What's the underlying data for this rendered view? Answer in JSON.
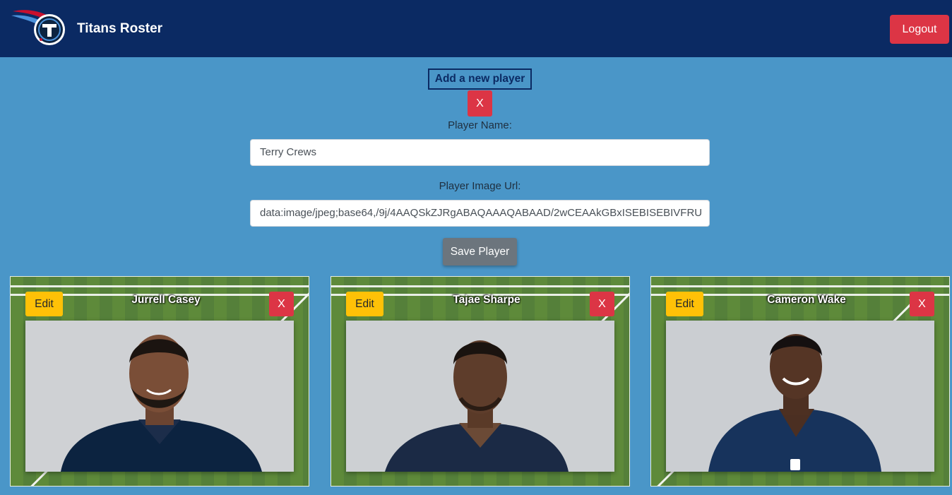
{
  "navbar": {
    "brand": "Titans Roster",
    "logout_label": "Logout",
    "logo_icon": "titans-logo"
  },
  "form": {
    "add_label": "Add a new player",
    "close_label": "X",
    "name_label": "Player Name:",
    "name_value": "Terry Crews",
    "url_label": "Player Image Url:",
    "url_value": "data:image/jpeg;base64,/9j/4AAQSkZJRgABAQAAAQABAAD/2wCEAAkGBxISEBISEBIVFRU",
    "save_label": "Save Player"
  },
  "players": [
    {
      "name": "Jurrell Casey",
      "edit_label": "Edit",
      "delete_label": "X"
    },
    {
      "name": "Tajae Sharpe",
      "edit_label": "Edit",
      "delete_label": "X"
    },
    {
      "name": "Cameron Wake",
      "edit_label": "Edit",
      "delete_label": "X"
    }
  ],
  "colors": {
    "navbar": "#0b2a63",
    "background": "#4a96c8",
    "danger": "#dc3545",
    "warning": "#ffc107",
    "secondary": "#6c757d"
  }
}
